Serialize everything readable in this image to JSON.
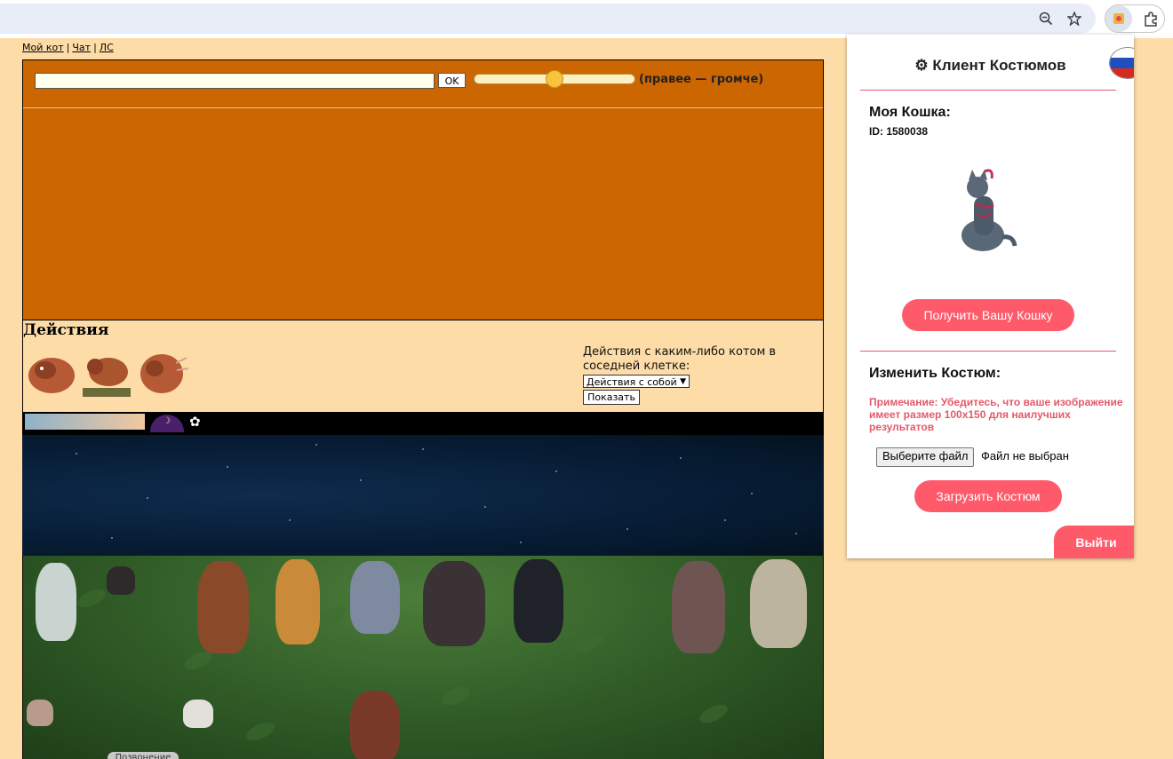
{
  "browser": {
    "zoom_icon": "zoom-out-icon",
    "bookmark_icon": "star-icon",
    "extension_icon": "extension-icon",
    "extensions_menu_icon": "puzzle-icon"
  },
  "nav": {
    "my_cat": "Мой кот",
    "chat": "Чат",
    "pm": "ЛС",
    "separator": "|"
  },
  "chat": {
    "input_value": "",
    "ok_label": "OK",
    "volume_label": "(правее — громче)",
    "volume_level": 0.5
  },
  "actions": {
    "title": "Действия",
    "other_cat_label": "Действия с каким-либо котом в соседней клетке:",
    "select_value": "Действия с собой",
    "show_label": "Показать"
  },
  "location": {
    "tooltip": "Позвонение"
  },
  "popup": {
    "title": "⚙ Клиент Костюмов",
    "my_cat_heading": "Моя Кошка:",
    "cat_id": "ID: 1580038",
    "get_cat_label": "Получить Вашу Кошку",
    "change_costume_heading": "Изменить Костюм:",
    "note": "Примечание: Убедитесь, что ваше изображение имеет размер 100x150 для наилучших результатов",
    "choose_file_label": "Выберите файл",
    "file_status": "Файл не выбран",
    "upload_label": "Загрузить Костюм",
    "logout_label": "Выйти",
    "accent_color": "#ff5a6a",
    "language_flag": "russia-flag-icon"
  }
}
